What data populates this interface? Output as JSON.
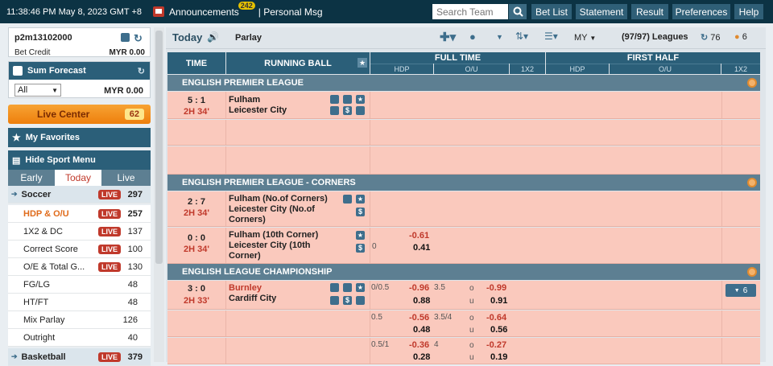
{
  "topbar": {
    "clock": "11:38:46 PM May 8, 2023 GMT +8",
    "announcements": "Announcements",
    "ann_count": "242",
    "personal_msg": "| Personal Msg",
    "search_placeholder": "Search Team",
    "buttons": [
      "Bet List",
      "Statement",
      "Result",
      "Preferences",
      "Help"
    ]
  },
  "account": {
    "username": "p2m13102000",
    "bet_credit_label": "Bet Credit",
    "bet_credit_value": "MYR  0.00"
  },
  "forecast": {
    "title": "Sum Forecast",
    "select_value": "All",
    "amount": "MYR 0.00"
  },
  "live_center": {
    "label": "Live Center",
    "count": "62"
  },
  "favorites": {
    "label": "My Favorites"
  },
  "sport_menu": {
    "title": "Hide Sport Menu",
    "tabs": [
      "Early",
      "Today",
      "Live"
    ],
    "items": [
      {
        "label": "Soccer",
        "live": "LIVE",
        "count": "297"
      },
      {
        "label": "HDP & O/U",
        "live": "LIVE",
        "count": "257"
      },
      {
        "label": "1X2 & DC",
        "live": "LIVE",
        "count": "137"
      },
      {
        "label": "Correct Score",
        "live": "LIVE",
        "count": "100"
      },
      {
        "label": "O/E & Total G...",
        "live": "LIVE",
        "count": "130"
      },
      {
        "label": "FG/LG",
        "count": "48"
      },
      {
        "label": "HT/FT",
        "count": "48"
      },
      {
        "label": "Mix Parlay",
        "count": "126"
      },
      {
        "label": "Outright",
        "count": "40"
      },
      {
        "label": "Basketball",
        "live": "LIVE",
        "count": "379"
      }
    ]
  },
  "main": {
    "title": "Today",
    "parlay": "Parlay",
    "odds_type": "MY",
    "leagues_count": "(97/97)",
    "leagues_label": "Leagues",
    "refresh_count": "76",
    "coin_count": "6"
  },
  "table": {
    "time_header": "TIME",
    "running_ball_header": "RUNNING BALL",
    "full_time_header": "FULL TIME",
    "first_half_header": "FIRST HALF",
    "sub_headers": [
      "HDP",
      "O/U",
      "1X2",
      "HDP",
      "O/U",
      "1X2"
    ]
  },
  "leagues": [
    {
      "name": "ENGLISH PREMIER LEAGUE",
      "matches": [
        {
          "score": "5 : 1",
          "time": "2H 34'",
          "home": "Fulham",
          "away": "Leicester City"
        }
      ]
    },
    {
      "name": "ENGLISH PREMIER LEAGUE - CORNERS",
      "matches": [
        {
          "score": "2 : 7",
          "time": "2H 34'",
          "home": "Fulham (No.of Corners)",
          "away": "Leicester City (No.of Corners)"
        },
        {
          "score": "0 : 0",
          "time": "2H 34'",
          "home": "Fulham (10th Corner)",
          "away": "Leicester City (10th Corner)",
          "hdp_line": "0",
          "hdp_home": "-0.61",
          "hdp_away": "0.41"
        }
      ]
    },
    {
      "name": "ENGLISH LEAGUE CHAMPIONSHIP",
      "matches": [
        {
          "score": "3 : 0",
          "time": "2H 33'",
          "home": "Burnley",
          "away": "Cardiff City",
          "more": "6",
          "lines": [
            {
              "hdp": "0/0.5",
              "hdp_home": "-0.96",
              "hdp_away": "0.88",
              "ou": "3.5",
              "over": "-0.99",
              "under": "0.91"
            },
            {
              "hdp": "0.5",
              "hdp_home": "-0.56",
              "hdp_away": "0.48",
              "ou": "3.5/4",
              "over": "-0.64",
              "under": "0.56"
            },
            {
              "hdp": "0.5/1",
              "hdp_home": "-0.36",
              "hdp_away": "0.28",
              "ou": "4",
              "over": "-0.27",
              "under": "0.19"
            }
          ]
        }
      ]
    }
  ],
  "ou_labels": {
    "over": "o",
    "under": "u"
  },
  "colors": {
    "header": "#2b5f79",
    "live": "#c0392b",
    "row": "#fac9bd",
    "topbar": "#0c3344"
  }
}
